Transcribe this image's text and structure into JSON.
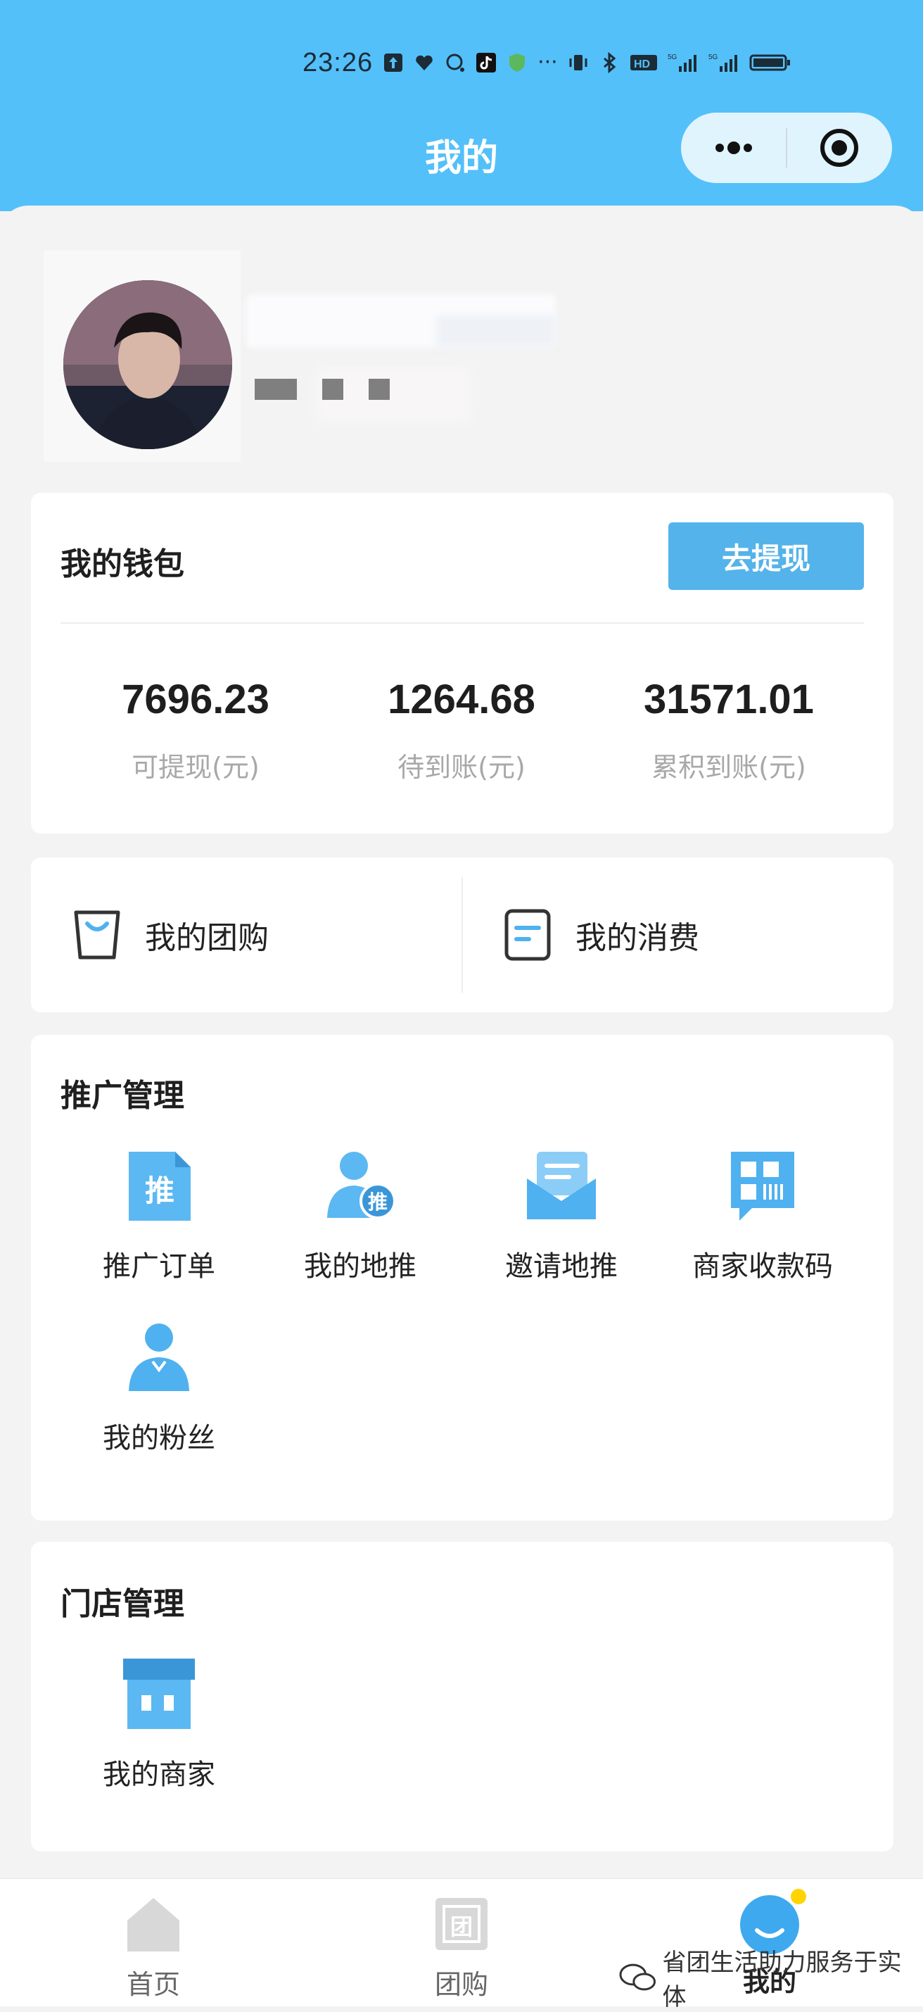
{
  "status_bar": {
    "time": "23:26",
    "icons": [
      "upload-icon",
      "heart-icon",
      "chat-icon",
      "tiktok-icon",
      "shield-icon",
      "more-icon",
      "vibrate-icon",
      "bluetooth-icon",
      "hd-icon",
      "signal-5g-icon",
      "signal-5g-icon",
      "battery-icon"
    ]
  },
  "header": {
    "title": "我的",
    "menu_icon": "more-dots-icon",
    "close_icon": "target-circle-icon"
  },
  "wallet": {
    "title": "我的钱包",
    "withdraw_button": "去提现",
    "stats": [
      {
        "value": "7696.23",
        "label": "可提现(元)"
      },
      {
        "value": "1264.68",
        "label": "待到账(元)"
      },
      {
        "value": "31571.01",
        "label": "累积到账(元)"
      }
    ]
  },
  "quick_links": [
    {
      "label": "我的团购",
      "icon": "shopping-bag-icon"
    },
    {
      "label": "我的消费",
      "icon": "receipt-icon"
    }
  ],
  "promotion": {
    "title": "推广管理",
    "items": [
      {
        "label": "推广订单",
        "icon": "promo-order-icon",
        "glyph": "推"
      },
      {
        "label": "我的地推",
        "icon": "user-promo-icon",
        "glyph": "推"
      },
      {
        "label": "邀请地推",
        "icon": "invite-mail-icon"
      },
      {
        "label": "商家收款码",
        "icon": "qr-code-icon"
      },
      {
        "label": "我的粉丝",
        "icon": "fans-icon"
      }
    ]
  },
  "store": {
    "title": "门店管理",
    "items": [
      {
        "label": "我的商家",
        "icon": "storefront-icon"
      }
    ]
  },
  "tabbar": [
    {
      "label": "首页",
      "icon": "home-icon",
      "active": false
    },
    {
      "label": "团购",
      "icon": "group-buy-icon",
      "glyph": "团",
      "active": false
    },
    {
      "label": "我的",
      "icon": "profile-smile-icon",
      "active": true
    }
  ],
  "watermark": "省团生活助力服务于实体",
  "colors": {
    "header": "#54c0f9",
    "accent": "#54b3ea",
    "icon_blue": "#4fb1ef"
  }
}
